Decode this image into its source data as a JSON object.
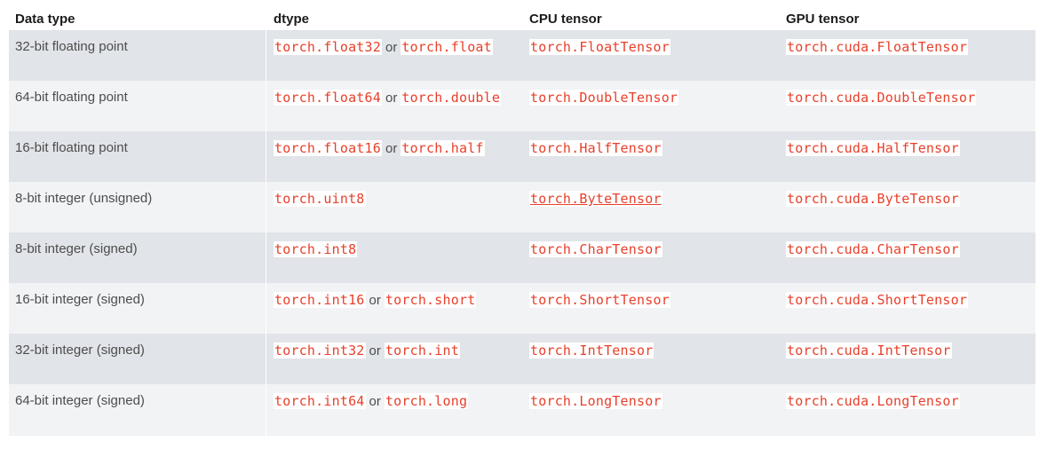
{
  "headers": [
    "Data type",
    "dtype",
    "CPU tensor",
    "GPU tensor"
  ],
  "or_word": "or",
  "rows": [
    {
      "type": "32-bit floating point",
      "dtype": [
        "torch.float32",
        "torch.float"
      ],
      "cpu": "torch.FloatTensor",
      "gpu": "torch.cuda.FloatTensor"
    },
    {
      "type": "64-bit floating point",
      "dtype": [
        "torch.float64",
        "torch.double"
      ],
      "cpu": "torch.DoubleTensor",
      "gpu": "torch.cuda.DoubleTensor"
    },
    {
      "type": "16-bit floating point",
      "dtype": [
        "torch.float16",
        "torch.half"
      ],
      "cpu": "torch.HalfTensor",
      "gpu": "torch.cuda.HalfTensor"
    },
    {
      "type": "8-bit integer (unsigned)",
      "dtype": [
        "torch.uint8"
      ],
      "cpu": "torch.ByteTensor",
      "gpu": "torch.cuda.ByteTensor"
    },
    {
      "type": "8-bit integer (signed)",
      "dtype": [
        "torch.int8"
      ],
      "cpu": "torch.CharTensor",
      "gpu": "torch.cuda.CharTensor"
    },
    {
      "type": "16-bit integer (signed)",
      "dtype": [
        "torch.int16",
        "torch.short"
      ],
      "cpu": "torch.ShortTensor",
      "gpu": "torch.cuda.ShortTensor"
    },
    {
      "type": "32-bit integer (signed)",
      "dtype": [
        "torch.int32",
        "torch.int"
      ],
      "cpu": "torch.IntTensor",
      "gpu": "torch.cuda.IntTensor"
    },
    {
      "type": "64-bit integer (signed)",
      "dtype": [
        "torch.int64",
        "torch.long"
      ],
      "cpu": "torch.LongTensor",
      "gpu": "torch.cuda.LongTensor"
    }
  ]
}
